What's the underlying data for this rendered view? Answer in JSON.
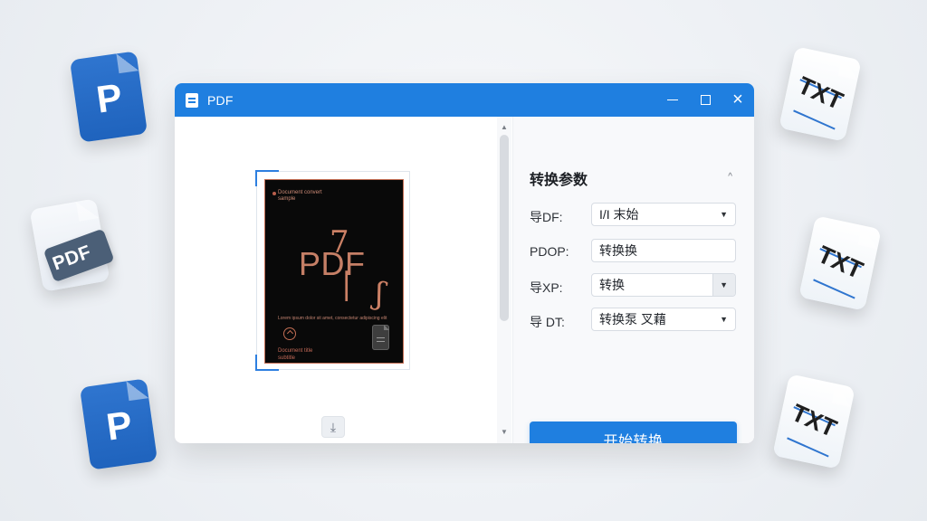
{
  "window": {
    "title": "PDF"
  },
  "floating_docs": {
    "left_top": "P",
    "left_mid": "PDF",
    "left_bottom": "P",
    "right_top": "TXT",
    "right_mid": "TXT",
    "right_bottom": "TXT"
  },
  "preview": {
    "title": "PDF",
    "small_top": "Document convert\nsample",
    "small_line": "Lorem ipsum dolor sit amet, consectetur adipiscing elit",
    "footer": "Document title\nsubtitle",
    "zoom_button": "⤓"
  },
  "panel": {
    "section_title": "转换参数",
    "rows": [
      {
        "label": "导DF:",
        "value": "I/I 末始",
        "has_dropdown": true,
        "style": "normal"
      },
      {
        "label": "PDOP:",
        "value": "转换换",
        "has_dropdown": false,
        "style": "plain"
      },
      {
        "label": "导XP:",
        "value": "转换",
        "has_dropdown": true,
        "style": "gray-arrow"
      },
      {
        "label": "导 DT:",
        "value": "转换泵  叉藉",
        "has_dropdown": true,
        "style": "normal"
      }
    ],
    "start_button": "开始转换"
  },
  "icons": {
    "app": "document-icon",
    "minimize": "minimize-icon",
    "maximize": "maximize-icon",
    "close": "close-icon",
    "collapse": "chevron-up-icon",
    "dropdown": "chevron-down-icon",
    "scroll_up": "scroll-up-icon",
    "scroll_down": "scroll-down-icon",
    "zoom": "zoom-icon"
  }
}
